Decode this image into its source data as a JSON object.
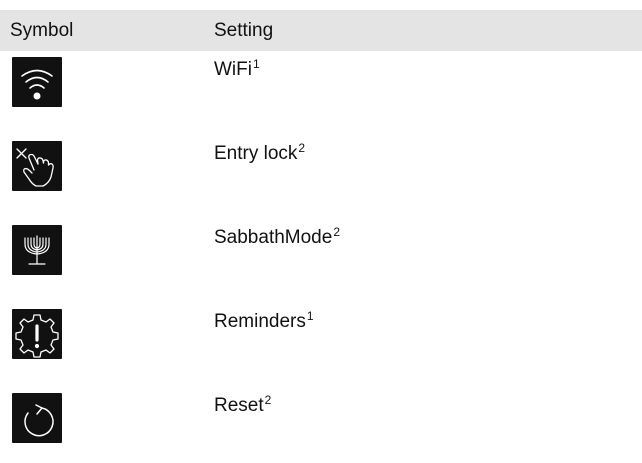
{
  "header": {
    "symbol_label": "Symbol",
    "setting_label": "Setting"
  },
  "rows": [
    {
      "icon": "wifi-icon",
      "label": "WiFi",
      "note": "1"
    },
    {
      "icon": "entry-lock-icon",
      "label": "Entry lock",
      "note": "2"
    },
    {
      "icon": "menorah-icon",
      "label": "SabbathMode",
      "note": "2"
    },
    {
      "icon": "reminder-gear-icon",
      "label": "Reminders",
      "note": "1"
    },
    {
      "icon": "reset-icon",
      "label": "Reset",
      "note": "2"
    }
  ],
  "colors": {
    "header_background": "#e4e4e4",
    "icon_background": "#111111",
    "icon_foreground": "#ffffff",
    "text": "#111111"
  }
}
